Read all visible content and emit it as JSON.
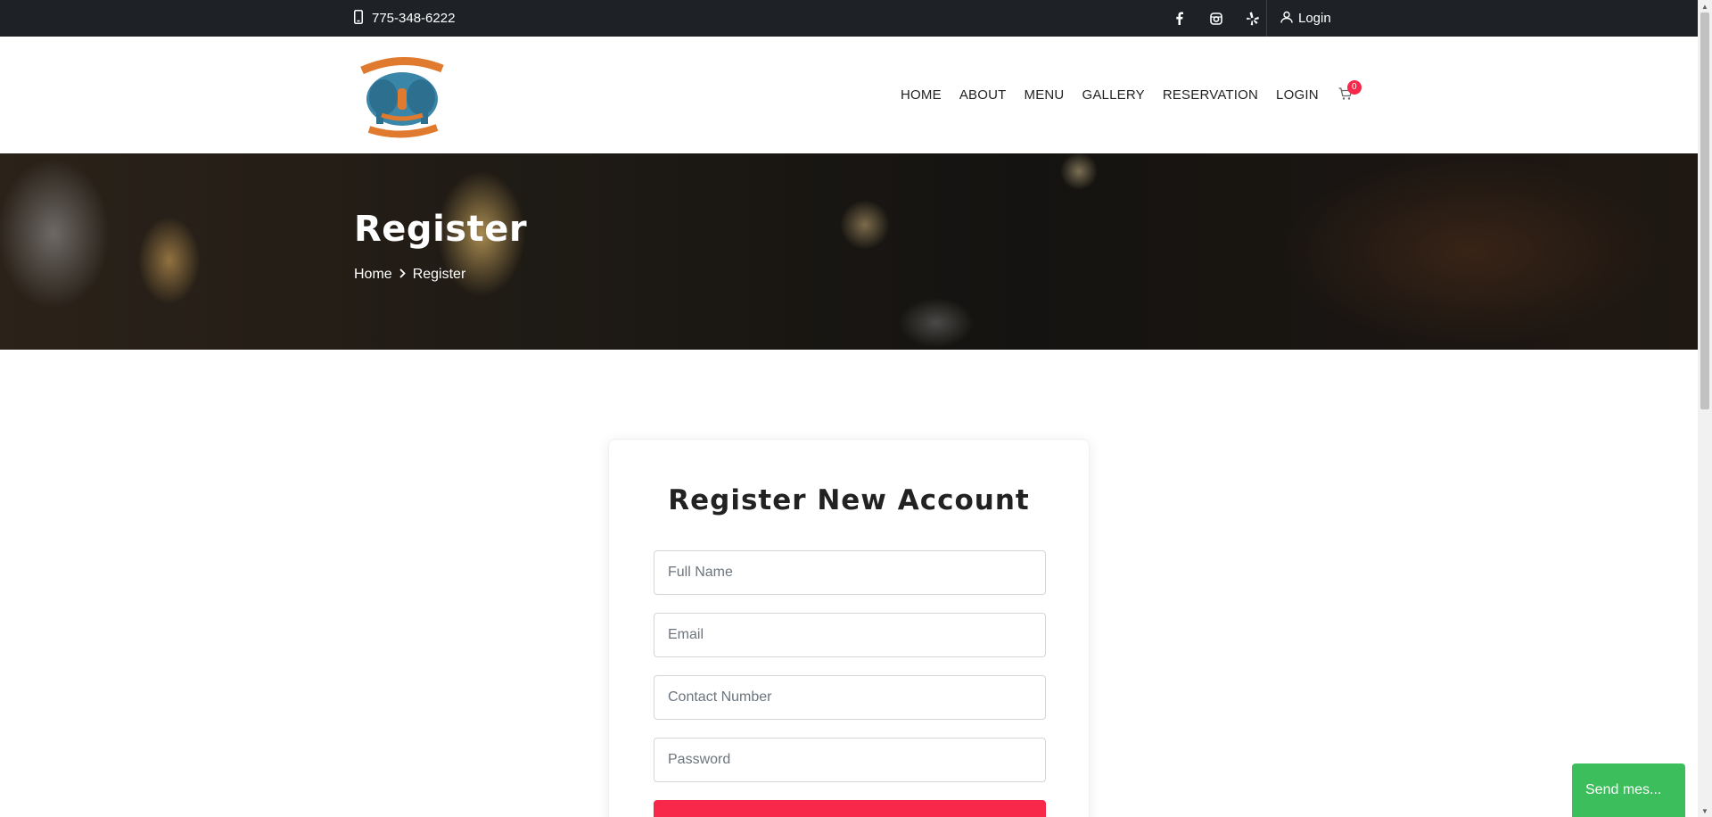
{
  "topbar": {
    "phone": "775-348-6222",
    "social": [
      "facebook-icon",
      "instagram-icon",
      "yelp-icon"
    ],
    "login_label": "Login"
  },
  "header": {
    "logo_alt": "India Kabab & Curry Restaurant",
    "nav": [
      "HOME",
      "ABOUT",
      "MENU",
      "GALLERY",
      "RESERVATION",
      "LOGIN"
    ],
    "cart_count": "0"
  },
  "hero": {
    "title": "Register",
    "breadcrumb": [
      "Home",
      "Register"
    ]
  },
  "form": {
    "title": "Register New Account",
    "full_name_placeholder": "Full Name",
    "email_placeholder": "Email",
    "contact_placeholder": "Contact Number",
    "password_placeholder": "Password"
  },
  "chat": {
    "label": "Send mes..."
  },
  "colors": {
    "topbar": "#1e2226",
    "accent": "#f7284a",
    "chat": "#3dbe5c"
  }
}
